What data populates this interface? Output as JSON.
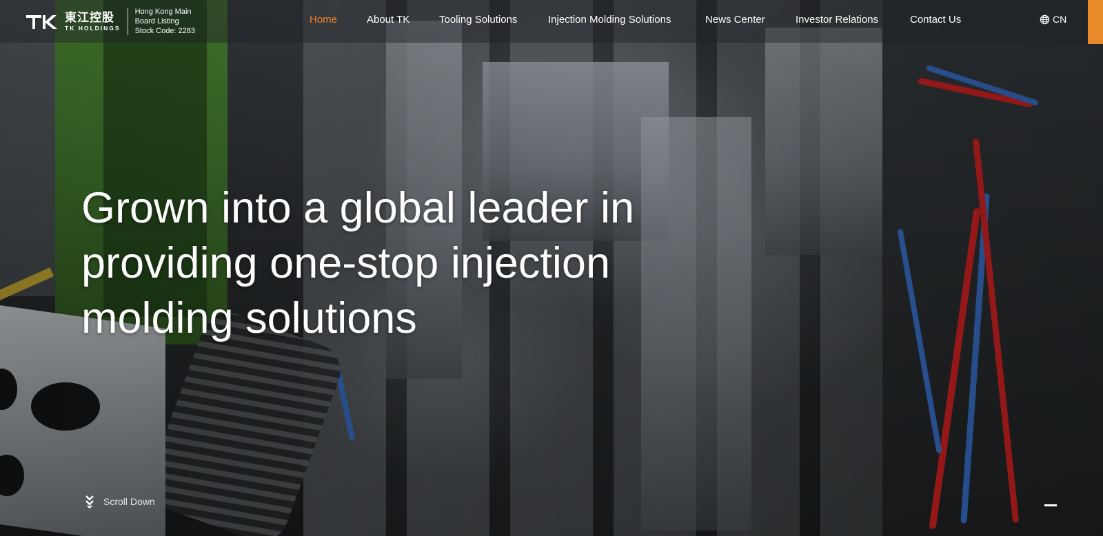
{
  "header": {
    "logo": {
      "cn_name": "東江控股",
      "en_name": "TK HOLDINGS",
      "mark": "TK"
    },
    "listing": {
      "line1": "Hong Kong Main",
      "line2": "Board Listing",
      "line3": "Stock Code: 2283"
    },
    "nav": [
      {
        "label": "Home",
        "active": true
      },
      {
        "label": "About TK",
        "active": false
      },
      {
        "label": "Tooling Solutions",
        "active": false
      },
      {
        "label": "Injection Molding Solutions",
        "active": false
      },
      {
        "label": "News Center",
        "active": false
      },
      {
        "label": "Investor Relations",
        "active": false
      },
      {
        "label": "Contact Us",
        "active": false
      }
    ],
    "language": {
      "icon": "globe-icon",
      "label": "CN"
    }
  },
  "hero": {
    "headline_lines": [
      "Grown into a global leader in",
      "providing one-stop injection",
      "molding solutions"
    ],
    "scroll_label": "Scroll Down",
    "scroll_icon": "double-chevron-down-icon"
  },
  "colors": {
    "accent": "#f0892b",
    "tab": "#e98a2a",
    "text": "#ffffff"
  }
}
